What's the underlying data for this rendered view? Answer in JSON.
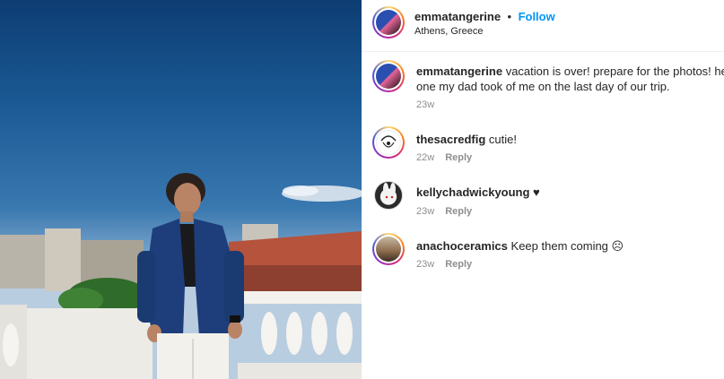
{
  "post": {
    "author": "emmatangerine",
    "follow_separator": "•",
    "follow_label": "Follow",
    "location": "Athens, Greece"
  },
  "caption": {
    "username": "emmatangerine",
    "text_line1": " vacation is over! prepare for the photos! here is",
    "text_line2": "one my dad took of me on the last day of our trip.",
    "time": "23w"
  },
  "comments": [
    {
      "username": "thesacredfig",
      "text": " cutie!",
      "time": "22w",
      "reply": "Reply"
    },
    {
      "username": "kellychadwickyoung",
      "text": " ♥",
      "time": "23w",
      "reply": "Reply"
    },
    {
      "username": "anachoceramics",
      "text": " Keep them coming ☹",
      "time": "23w",
      "reply": "Reply"
    }
  ],
  "colors": {
    "link": "#0095f6",
    "meta": "#8e8e8e",
    "text": "#262626"
  },
  "icons": [
    "post-photo",
    "avatar-emmatangerine",
    "avatar-thesacredfig",
    "avatar-kellychadwickyoung",
    "avatar-anachoceramics"
  ]
}
